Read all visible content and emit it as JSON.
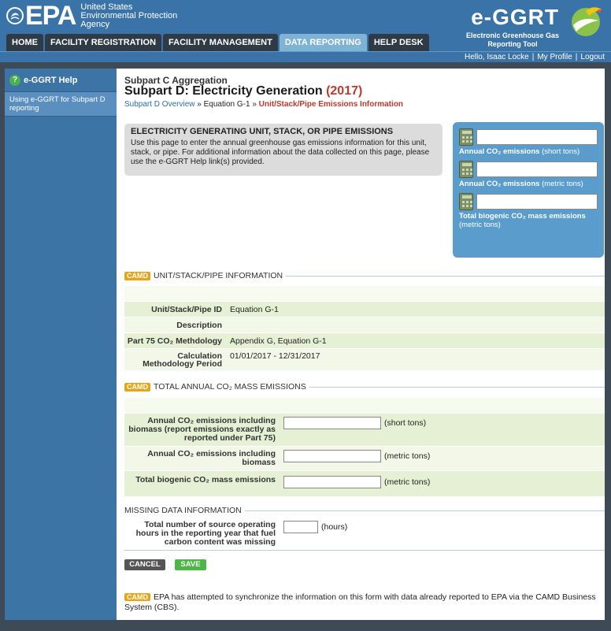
{
  "header": {
    "agency_lines": [
      "United States",
      "Environmental Protection",
      "Agency"
    ],
    "epa_word": "EPA",
    "tool_title": "e-GGRT",
    "tool_subtitle_lines": [
      "Electronic Greenhouse Gas",
      "Reporting Tool"
    ]
  },
  "nav": {
    "tabs": [
      {
        "label": "HOME",
        "active": false
      },
      {
        "label": "FACILITY REGISTRATION",
        "active": false
      },
      {
        "label": "FACILITY MANAGEMENT",
        "active": false
      },
      {
        "label": "DATA REPORTING",
        "active": true
      },
      {
        "label": "HELP DESK",
        "active": false
      }
    ]
  },
  "userbar": {
    "greeting": "Hello, Isaac Locke",
    "profile": "My Profile",
    "logout": "Logout"
  },
  "sidebar": {
    "help_title": "e-GGRT Help",
    "help_link": "Using e-GGRT for Subpart D reporting"
  },
  "page": {
    "subpart_small": "Subpart C Aggregation",
    "title": "Subpart D: Electricity Generation",
    "year": "(2017)",
    "breadcrumb": {
      "overview": "Subpart D Overview",
      "sep1": " » ",
      "eq": "Equation G-1",
      "sep2": " » ",
      "current": "Unit/Stack/Pipe Emissions Information"
    }
  },
  "info_box": {
    "heading": "ELECTRICITY GENERATING UNIT, STACK, OR PIPE EMISSIONS",
    "text": "Use this page to enter the annual greenhouse gas emissions information for this unit, stack, or pipe. For additional information about the data collected on this page, please use the e-GGRT Help link(s) provided."
  },
  "calc_panel": {
    "items": [
      {
        "label": "Annual CO₂ emissions",
        "unit": "(short tons)",
        "value": ""
      },
      {
        "label": "Annual CO₂ emissions",
        "unit": "(metric tons)",
        "value": ""
      },
      {
        "label": "Total biogenic CO₂ mass emissions",
        "unit": "(metric tons)",
        "value": ""
      }
    ]
  },
  "sections": {
    "camd_badge": "CAMD",
    "unit_info_title": "UNIT/STACK/PIPE INFORMATION",
    "total_title": "TOTAL ANNUAL CO₂ MASS EMISSIONS",
    "missing_title": "MISSING DATA INFORMATION"
  },
  "unit_info": [
    {
      "label": "Unit/Stack/Pipe ID",
      "value": "Equation G-1"
    },
    {
      "label": "Description",
      "value": ""
    },
    {
      "label": "Part 75 CO₂ Methdology",
      "value": "Appendix G, Equation G-1"
    },
    {
      "label": "Calculation Methodology Period",
      "value": "01/01/2017 - 12/31/2017"
    }
  ],
  "total_emissions": [
    {
      "label": "Annual CO₂ emissions including biomass (report emissions exactly as reported under Part 75)",
      "unit": "(short tons)",
      "value": ""
    },
    {
      "label": "Annual CO₂ emissions including biomass",
      "unit": "(metric tons)",
      "value": ""
    },
    {
      "label": "Total biogenic CO₂ mass emissions",
      "unit": "(metric tons)",
      "value": ""
    }
  ],
  "missing_data": {
    "label": "Total number of source operating hours in the reporting year that fuel carbon content was missing",
    "unit": "(hours)",
    "value": ""
  },
  "buttons": {
    "cancel": "CANCEL",
    "save": "SAVE"
  },
  "footer_note": "EPA has attempted to synchronize the information on this form with data already reported to EPA via the CAMD Business System (CBS).",
  "colors": {
    "header_blue": "#3a73a8",
    "accent_red": "#c0392b",
    "camd_orange": "#e8a417",
    "save_green": "#4cb748"
  }
}
